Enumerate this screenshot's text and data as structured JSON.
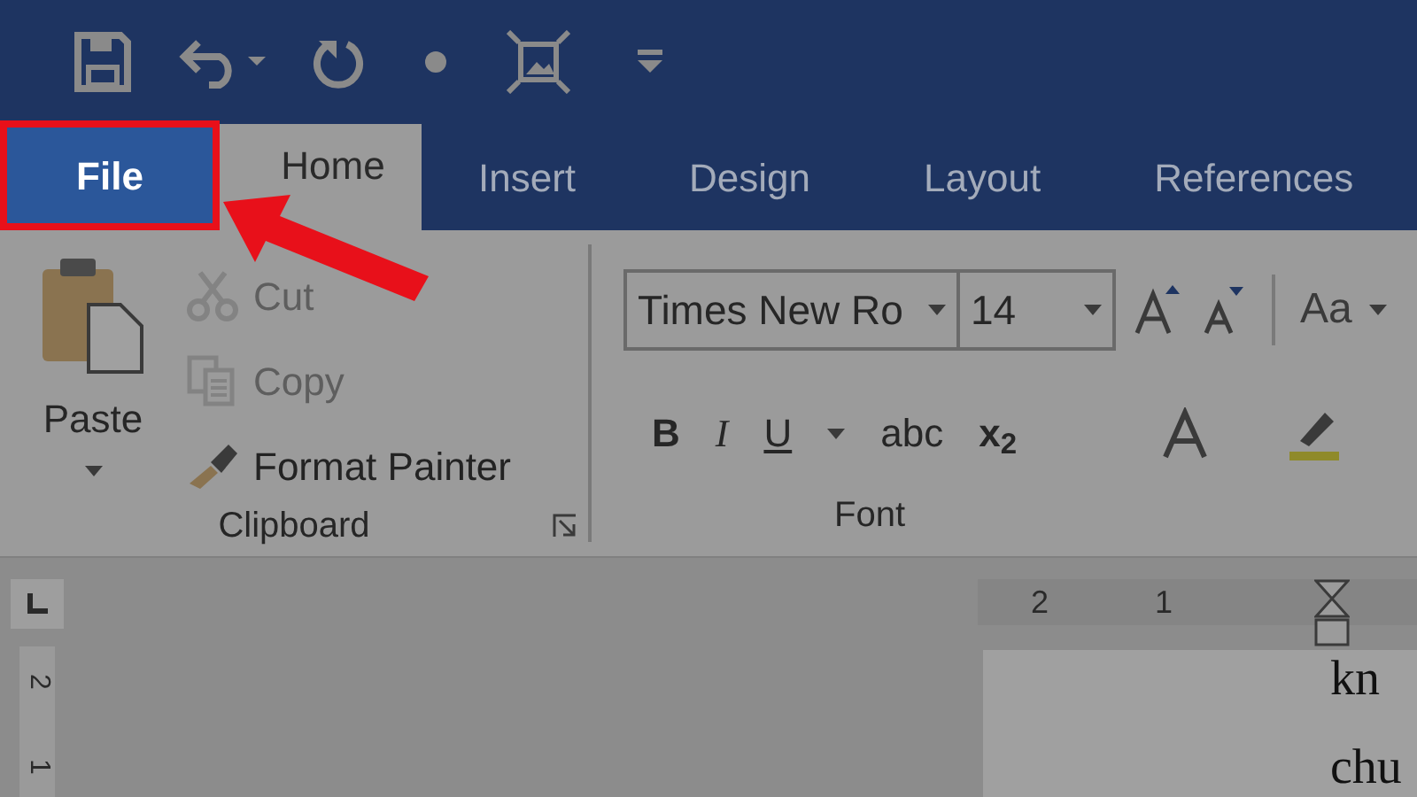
{
  "tabs": [
    {
      "label": "File",
      "kind": "file",
      "selected": true,
      "annotated": true
    },
    {
      "label": "Home",
      "kind": "tab",
      "selected": true,
      "annotated": false
    },
    {
      "label": "Insert",
      "kind": "tab",
      "selected": false,
      "annotated": false
    },
    {
      "label": "Design",
      "kind": "tab",
      "selected": false,
      "annotated": false
    },
    {
      "label": "Layout",
      "kind": "tab",
      "selected": false,
      "annotated": false
    },
    {
      "label": "References",
      "kind": "tab",
      "selected": false,
      "annotated": false
    }
  ],
  "clipboard": {
    "title": "Clipboard",
    "paste_label": "Paste",
    "items": [
      {
        "label": "Cut",
        "kind": "cut",
        "disabled": true
      },
      {
        "label": "Copy",
        "kind": "copy",
        "disabled": true
      },
      {
        "label": "Format Painter",
        "kind": "painter",
        "disabled": false
      }
    ]
  },
  "font": {
    "title": "Font",
    "font_name": "Times New Ro",
    "font_size": "14",
    "change_case": "Aa",
    "format_buttons": [
      {
        "label": "B",
        "kind": "bold"
      },
      {
        "label": "I",
        "kind": "italic"
      },
      {
        "label": "U",
        "kind": "underline"
      },
      {
        "label": "abc",
        "kind": "strike"
      },
      {
        "label": "x$_{2}$",
        "kind": "subscript"
      }
    ]
  },
  "ruler": {
    "horizontal_labels": [
      "2",
      "1"
    ],
    "vertical_labels": [
      "2",
      "1"
    ]
  },
  "document": {
    "lines": [
      "kn",
      "chu"
    ]
  }
}
